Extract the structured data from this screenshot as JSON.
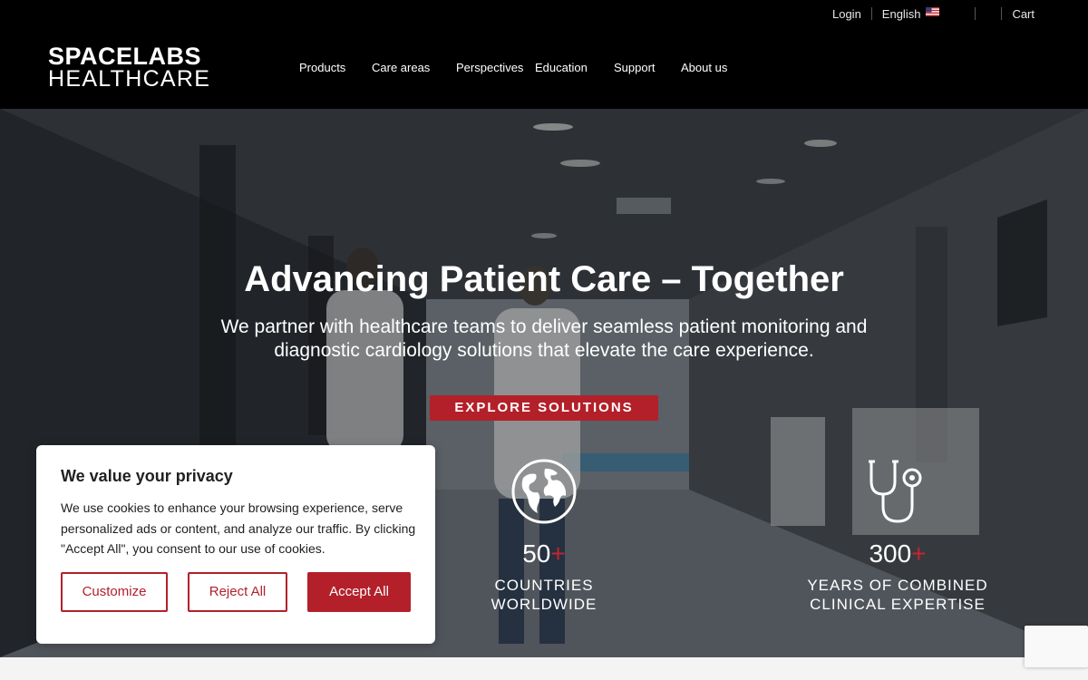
{
  "utility_nav": {
    "login": "Login",
    "language": "English",
    "cart": "Cart"
  },
  "logo": {
    "line1": "SPACELABS",
    "line2": "HEALTHCARE"
  },
  "main_nav": {
    "items": [
      "Products",
      "Care areas",
      "Perspectives",
      "Education",
      "Support",
      "About us"
    ]
  },
  "hero": {
    "title": "Advancing Patient Care – Together",
    "subtitle_line1": "We partner with healthcare teams to deliver seamless patient monitoring and",
    "subtitle_line2": "diagnostic cardiology solutions that elevate the care experience.",
    "cta_label": "EXPLORE SOLUTIONS"
  },
  "stats": [
    {
      "icon": "globe-icon",
      "number": "50",
      "suffix": "+",
      "label_line1": "COUNTRIES",
      "label_line2": "WORLDWIDE"
    },
    {
      "icon": "stethoscope-icon",
      "number": "300",
      "suffix": "+",
      "label_line1": "YEARS OF COMBINED",
      "label_line2": "CLINICAL EXPERTISE"
    }
  ],
  "cookie_banner": {
    "title": "We value your privacy",
    "text": "We use cookies to enhance your browsing experience, serve personalized ads or content, and analyze our traffic. By clicking \"Accept All\", you consent to our use of cookies.",
    "customize_label": "Customize",
    "reject_label": "Reject All",
    "accept_label": "Accept All"
  },
  "colors": {
    "brand_red": "#b3202a",
    "header_bg": "#000000",
    "plus_red": "#c4252f"
  }
}
